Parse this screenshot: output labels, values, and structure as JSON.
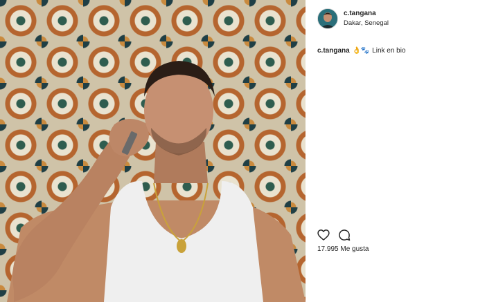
{
  "post": {
    "username": "c.tangana",
    "location": "Dakar, Senegal",
    "caption": {
      "username": "c.tangana",
      "emojis": "👌🐾",
      "text": "Link en bio"
    },
    "likes_text": "17.995 Me gusta"
  },
  "icons": {
    "like": "heart-icon",
    "comment": "comment-icon"
  },
  "colors": {
    "text": "#262626",
    "background": "#ffffff",
    "avatar_bg": "#2b6f7a"
  }
}
